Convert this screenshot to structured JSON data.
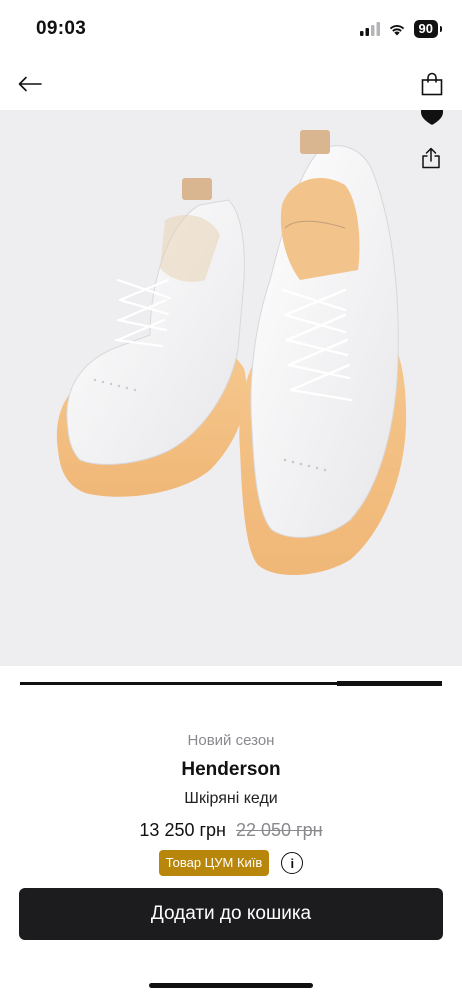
{
  "status": {
    "time": "09:03",
    "battery": "90"
  },
  "product": {
    "season": "Новий сезон",
    "brand": "Henderson",
    "description": "Шкіряні кеди",
    "price": "13 250 грн",
    "old_price": "22 050 грн",
    "store_badge": "Товар ЦУМ Київ",
    "info_glyph": "i"
  },
  "gallery": {
    "image_alt": "white leather sneakers with translucent orange soles",
    "progress": 0.25
  },
  "actions": {
    "add_to_cart": "Додати до кошика"
  },
  "icons": {
    "back": "arrow-left-icon",
    "bag": "shopping-bag-icon",
    "favorite": "heart-icon",
    "share": "share-icon"
  },
  "colors": {
    "badge": "#b8860b",
    "button": "#1c1c1e",
    "hero_bg": "#eeeef0",
    "muted": "#8a8a8e"
  }
}
